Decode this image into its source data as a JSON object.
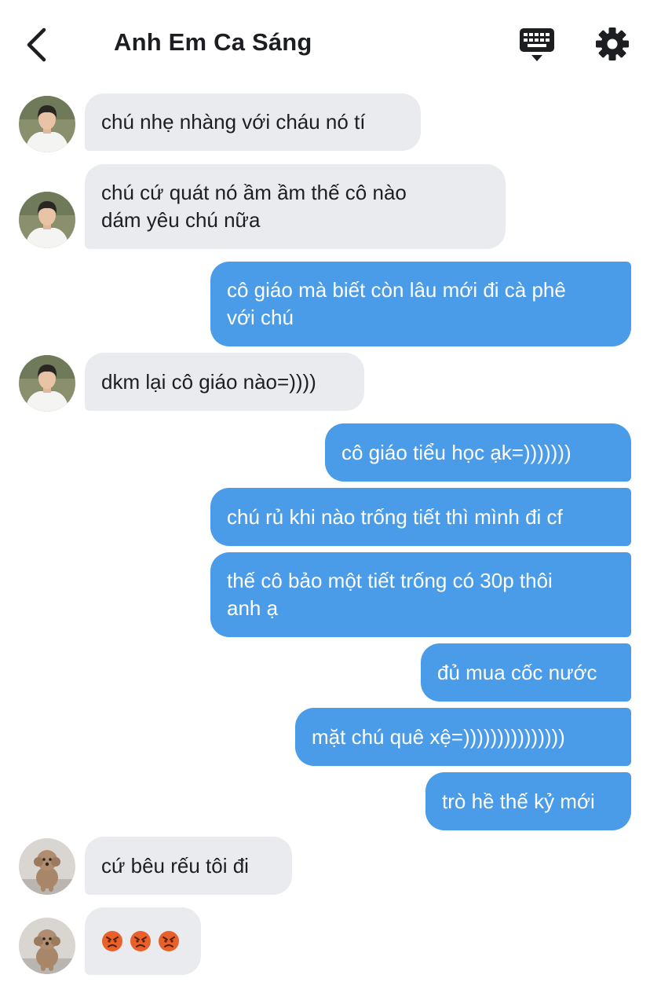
{
  "header": {
    "title": "Anh Em Ca Sáng",
    "back_icon": "chevron-left-icon",
    "keyboard_icon": "keyboard-icon",
    "settings_icon": "gear-icon"
  },
  "colors": {
    "outgoing_bubble": "#4a9be8",
    "incoming_bubble": "#e9ebef",
    "emoji_face": "#e8602a"
  },
  "messages": [
    {
      "side": "in",
      "avatar": "avatar-boy",
      "text": "chú nhẹ nhàng với cháu nó tí"
    },
    {
      "side": "in",
      "avatar": "avatar-boy",
      "text": "chú cứ quát nó ầm ầm thế cô nào\ndám yêu chú nữa"
    },
    {
      "side": "out",
      "text": "cô giáo mà biết còn lâu mới đi cà phê\nvới chú"
    },
    {
      "side": "in",
      "avatar": "avatar-boy",
      "text": "dkm lại cô giáo nào=))))"
    },
    {
      "side": "out",
      "text": "cô giáo tiểu học ạk=)))))))"
    },
    {
      "side": "out",
      "text": "chú rủ khi nào trống tiết thì mình đi cf"
    },
    {
      "side": "out",
      "text": "thế cô bảo một tiết trống có 30p thôi\nanh ạ"
    },
    {
      "side": "out",
      "text": "đủ mua cốc nước"
    },
    {
      "side": "out",
      "text": "mặt chú quê xệ=)))))))))))))))"
    },
    {
      "side": "out",
      "text": "trò hề thế kỷ mới"
    },
    {
      "side": "in",
      "avatar": "avatar-dog",
      "text": "cứ bêu rếu tôi đi"
    },
    {
      "side": "in",
      "avatar": "avatar-dog",
      "emoji": [
        "angry-face-icon",
        "angry-face-icon",
        "angry-face-icon"
      ]
    }
  ]
}
